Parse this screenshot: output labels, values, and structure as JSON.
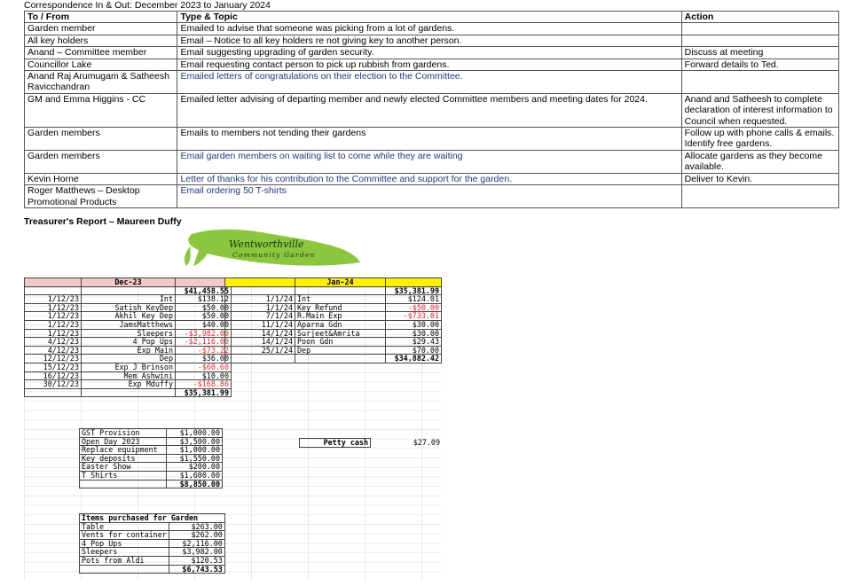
{
  "doc_title": "Correspondence In & Out: December 2023 to January 2024",
  "corr_headers": [
    "To / From",
    "Type & Topic",
    "Action"
  ],
  "corr_rows": [
    {
      "from": "Garden member",
      "topic": "Emailed to advise that someone was picking from a lot of gardens.",
      "action": "",
      "blue": false
    },
    {
      "from": "All key holders",
      "topic": "Email – Notice to all key holders re not giving key to another person.",
      "action": "",
      "blue": false
    },
    {
      "from": "Anand – Committee member",
      "topic": "Email suggesting upgrading of garden security.",
      "action": "Discuss at meeting",
      "blue": false
    },
    {
      "from": "Councillor Lake",
      "topic": "Email requesting contact person to pick up rubbish from gardens.",
      "action": "Forward details to Ted.",
      "blue": false
    },
    {
      "from": "Anand Raj Arumugam & Satheesh Ravicchandran",
      "topic": "Emailed letters of congratulations on their election to the Committee.",
      "action": "",
      "blue": true
    },
    {
      "from": "GM and Emma Higgins - CC",
      "topic": "Emailed letter advising of departing member and newly elected Committee members and meeting dates for 2024.",
      "action": "Anand and Satheesh to complete declaration of interest information to Council when requested.",
      "blue": false
    },
    {
      "from": "Garden members",
      "topic": "Emails to members not tending their gardens",
      "action": "Follow up with phone calls & emails. Identify free gardens.",
      "blue": false
    },
    {
      "from": "Garden members",
      "topic": "Email garden members on waiting list to come while they are waiting",
      "action": "Allocate gardens as they become available.",
      "blue": true
    },
    {
      "from": "Kevin Horne",
      "topic": "Letter of thanks for his contribution to the Committee and support for the garden.",
      "action": "Deliver to Kevin.",
      "blue": true
    },
    {
      "from": "Roger Matthews – Desktop Promotional Products",
      "topic": "Email ordering 50 T-shirts",
      "action": "",
      "blue": true
    }
  ],
  "treasurer_title": "Treasurer's Report – Maureen Duffy",
  "logo": {
    "line1": "Wentworthville",
    "line2": "Community Garden",
    "color": "#8cc63f"
  },
  "dec": {
    "header": "Dec-23",
    "opening": "$41,458.55",
    "rows": [
      {
        "date": "1/12/23",
        "desc": "Int",
        "amt": "$138.12",
        "neg": false
      },
      {
        "date": "1/12/23",
        "desc": "Satish KeyDep",
        "amt": "$50.00",
        "neg": false
      },
      {
        "date": "1/12/23",
        "desc": "Akhil Key Dep",
        "amt": "$50.00",
        "neg": false
      },
      {
        "date": "1/12/23",
        "desc": "JamsMatthews",
        "amt": "$40.00",
        "neg": false
      },
      {
        "date": "1/12/23",
        "desc": "Sleepers",
        "amt": "-$3,982.00",
        "neg": true
      },
      {
        "date": "4/12/23",
        "desc": "4 Pop Ups",
        "amt": "-$2,116.00",
        "neg": true
      },
      {
        "date": "4/12/23",
        "desc": "Exp Main",
        "amt": "-$73.22",
        "neg": true
      },
      {
        "date": "12/12/23",
        "desc": "Dep",
        "amt": "$36.00",
        "neg": false
      },
      {
        "date": "15/12/23",
        "desc": "Exp J Brinson",
        "amt": "-$60.60",
        "neg": true
      },
      {
        "date": "16/12/23",
        "desc": "Mem Ashwini",
        "amt": "$10.00",
        "neg": false
      },
      {
        "date": "30/12/23",
        "desc": "Exp Mduffy",
        "amt": "-$168.86",
        "neg": true
      }
    ],
    "closing": "$35,381.99"
  },
  "jan": {
    "header": "Jan-24",
    "opening": "$35,381.99",
    "rows": [
      {
        "date": "1/1/24",
        "desc": "Int",
        "amt": "$124.01",
        "neg": false
      },
      {
        "date": "1/1/24",
        "desc": "Key Refund",
        "amt": "-$50.00",
        "neg": true
      },
      {
        "date": "7/1/24",
        "desc": "R.Main Exp",
        "amt": "-$733.01",
        "neg": true
      },
      {
        "date": "11/1/24",
        "desc": "Aparna Gdn",
        "amt": "$30.00",
        "neg": false
      },
      {
        "date": "14/1/24",
        "desc": "Surjeet&Amrita",
        "amt": "$30.00",
        "neg": false
      },
      {
        "date": "14/1/24",
        "desc": "Poon Gdn",
        "amt": "$29.43",
        "neg": false
      },
      {
        "date": "25/1/24",
        "desc": "Dep",
        "amt": "$70.00",
        "neg": false
      }
    ],
    "closing": "$34,882.42"
  },
  "provisions": {
    "rows": [
      {
        "label": "GST Provision",
        "amt": "$1,000.00"
      },
      {
        "label": "Open Day 2023",
        "amt": "$3,500.00"
      },
      {
        "label": "Replace equipment",
        "amt": "$1,000.00"
      },
      {
        "label": "Key deposits",
        "amt": "$1,550.00"
      },
      {
        "label": "Easter Show",
        "amt": "$200.00"
      },
      {
        "label": "T Shirts",
        "amt": "$1,600.00"
      }
    ],
    "total": "$8,850.00"
  },
  "petty": {
    "label": "Petty cash",
    "amt": "$27.09"
  },
  "items": {
    "header": "Items purchased for Garden",
    "rows": [
      {
        "label": "Table",
        "amt": "$263.00"
      },
      {
        "label": "Vents for container",
        "amt": "$262.00"
      },
      {
        "label": "4 Pop Ups",
        "amt": "$2,116.00"
      },
      {
        "label": "Sleepers",
        "amt": "$3,982.00"
      },
      {
        "label": "Pots from Aldi",
        "amt": "$120.53"
      }
    ],
    "total": "$6,743.53"
  }
}
